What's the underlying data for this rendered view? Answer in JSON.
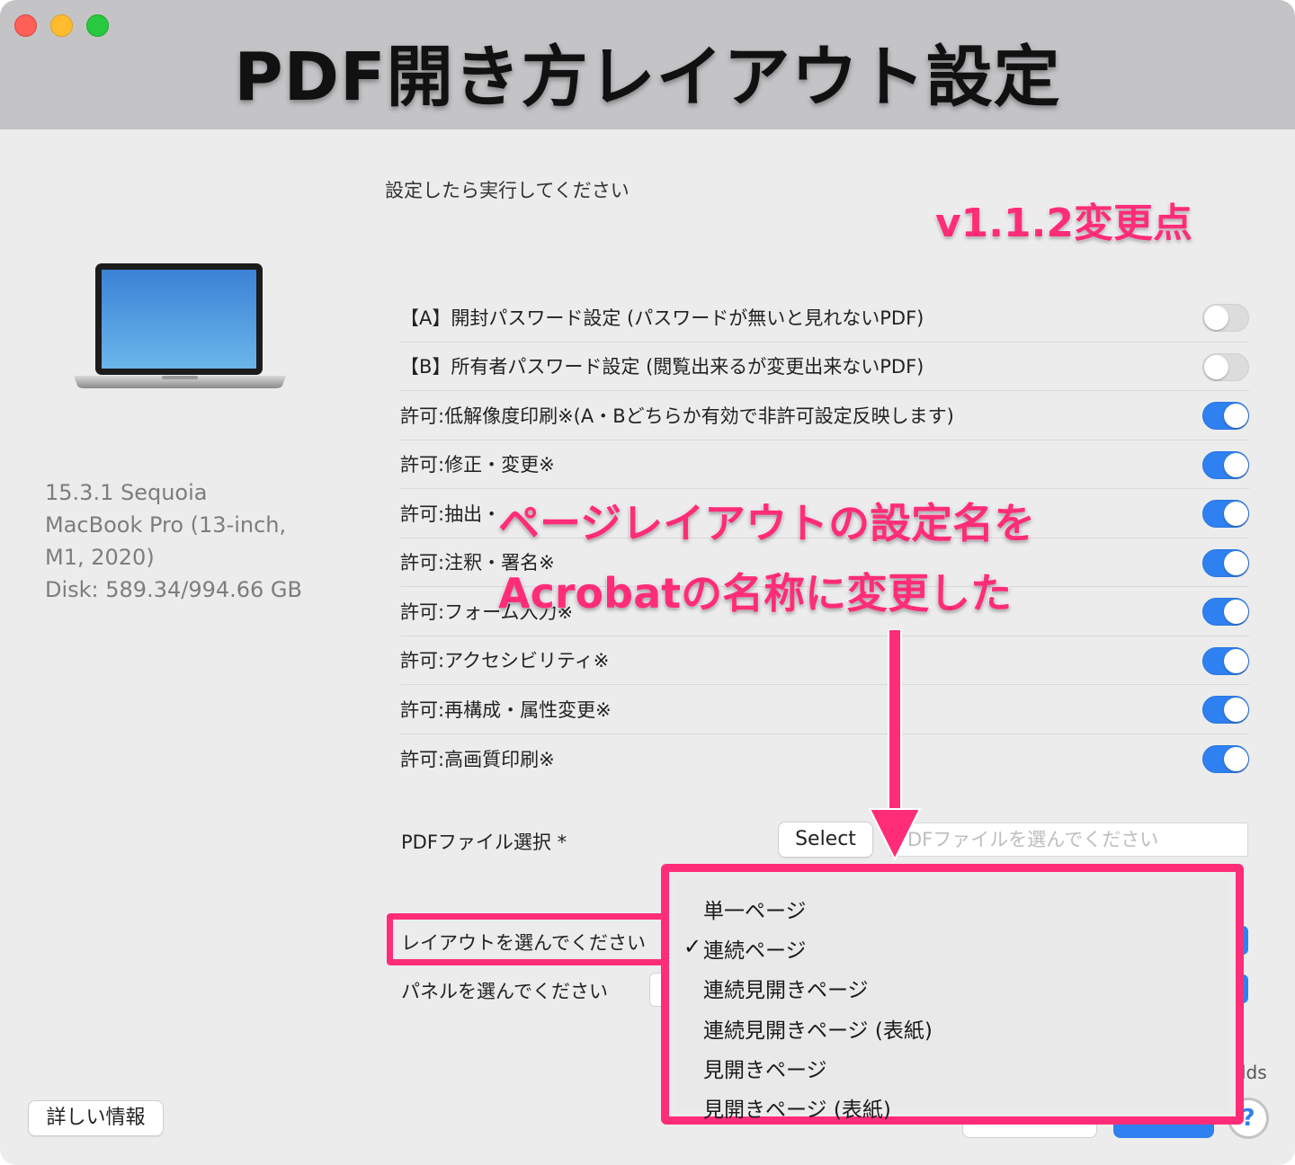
{
  "window": {
    "title": "PDF開き方レイアウト設定",
    "instruction": "設定したら実行してください",
    "version_note": "v1.1.2変更点"
  },
  "system_info": {
    "line1": "15.3.1 Sequoia",
    "line2": "MacBook Pro (13-inch,",
    "line3": "M1, 2020)",
    "line4": "Disk: 589.34/994.66 GB"
  },
  "settings": [
    {
      "label": "【A】開封パスワード設定 (パスワードが無いと見れないPDF)",
      "enabled": false
    },
    {
      "label": "【B】所有者パスワード設定 (閲覧出来るが変更出来ないPDF)",
      "enabled": false
    },
    {
      "label": "許可:低解像度印刷※(A・Bどちらか有効で非許可設定反映します)",
      "enabled": true
    },
    {
      "label": "許可:修正・変更※",
      "enabled": true
    },
    {
      "label": "許可:抽出・",
      "enabled": true
    },
    {
      "label": "許可:注釈・署名※",
      "enabled": true
    },
    {
      "label": "許可:フォーム入力※",
      "enabled": true
    },
    {
      "label": "許可:アクセシビリティ※",
      "enabled": true
    },
    {
      "label": "許可:再構成・属性変更※",
      "enabled": true
    },
    {
      "label": "許可:高画質印刷※",
      "enabled": true
    }
  ],
  "file": {
    "label": "PDFファイル選択 *",
    "select_button": "Select",
    "placeholder": "DFファイルを選んでください"
  },
  "layout_label": "レイアウトを選んでください",
  "panel_label": "パネルを選んでください",
  "truncated_text": "lds",
  "layout_menu": {
    "items": [
      "単一ページ",
      "連続ページ",
      "連続見開きページ",
      "連続見開きページ (表紙)",
      "見開きページ",
      "見開きページ (表紙)"
    ],
    "selected_index": 1,
    "check_mark": "✓"
  },
  "details_button": "詳しい情報",
  "help_button": "?",
  "annotations": {
    "line1": "ページレイアウトの設定名を",
    "line2": "Acrobatの名称に変更した"
  },
  "colors": {
    "accent_blue": "#2f80f0",
    "highlight_pink": "#ff2d78"
  }
}
